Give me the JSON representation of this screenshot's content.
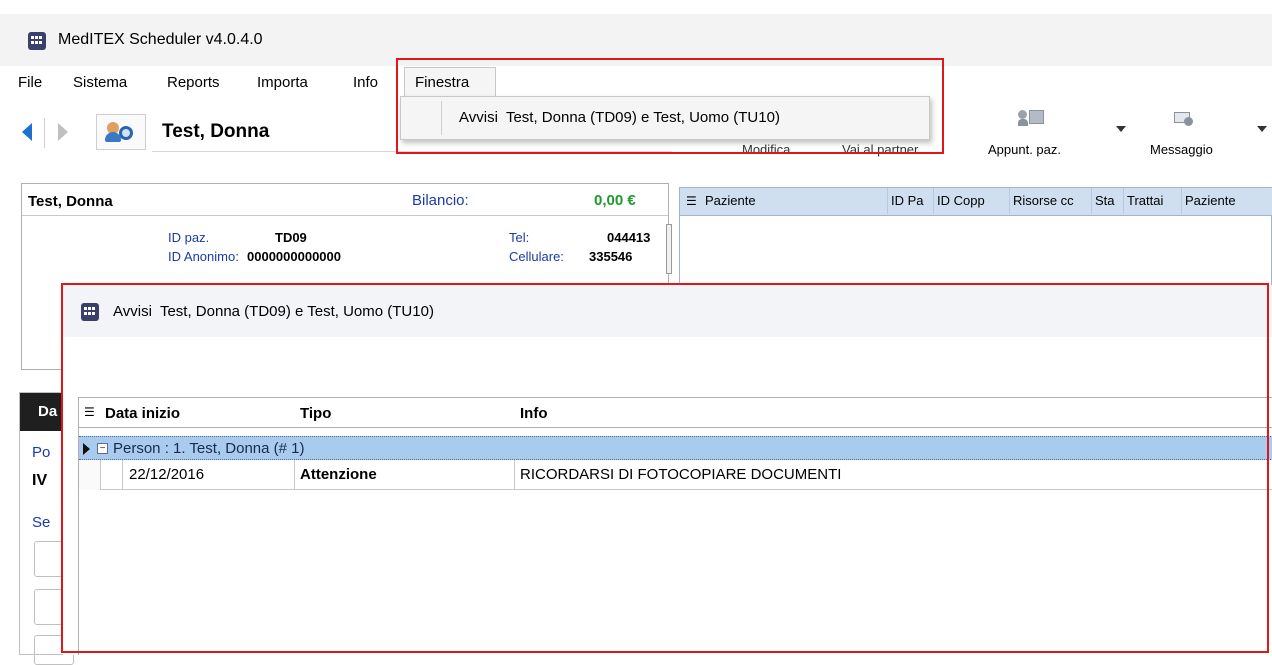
{
  "window": {
    "title": "MedITEX Scheduler v4.0.4.0"
  },
  "menubar": {
    "items": [
      {
        "label": "File"
      },
      {
        "label": "Sistema"
      },
      {
        "label": "Reports"
      },
      {
        "label": "Importa"
      },
      {
        "label": "Info"
      },
      {
        "label": "Finestra"
      }
    ]
  },
  "dropdown": {
    "items": [
      {
        "label": "Avvisi  Test, Donna (TD09) e Test, Uomo (TU10)"
      }
    ]
  },
  "toolbar": {
    "patient_name": "Test, Donna",
    "modifica_label": "Modifica",
    "partner_label": "Vai al partner",
    "appuntamenti_label": "Appunt. paz.",
    "messaggio_label": "Messaggio"
  },
  "patient_panel": {
    "name": "Test, Donna",
    "balance_label": "Bilancio:",
    "balance_value": "0,00 €",
    "id_label": "ID paz.",
    "id_value": "TD09",
    "anon_label": "ID Anonimo:",
    "anon_value": "0000000000000",
    "tel_label": "Tel:",
    "tel_value": "044413",
    "cell_label": "Cellulare:",
    "cell_value": "335546"
  },
  "right_grid": {
    "columns": [
      "Paziente",
      "ID Pa",
      "ID Copp",
      "Risorse cc",
      "Sta",
      "Trattai",
      "Paziente"
    ]
  },
  "left_partial": {
    "lines": [
      "Da",
      "Po",
      "IV",
      "Se"
    ]
  },
  "modal": {
    "title": "Avvisi  Test, Donna (TD09) e Test, Uomo (TU10)",
    "columns": [
      "Data inizio",
      "Tipo",
      "Info"
    ],
    "group_row": "Person : 1. Test, Donna (# 1)",
    "rows": [
      {
        "date": "22/12/2016",
        "type": "Attenzione",
        "info": "RICORDARSI DI FOTOCOPIARE DOCUMENTI"
      }
    ]
  },
  "colors": {
    "accent": "#1e6fd0",
    "highlight_red": "#e0161b",
    "balance_green": "#1c9a2a",
    "group_row": "#a9cbef"
  }
}
